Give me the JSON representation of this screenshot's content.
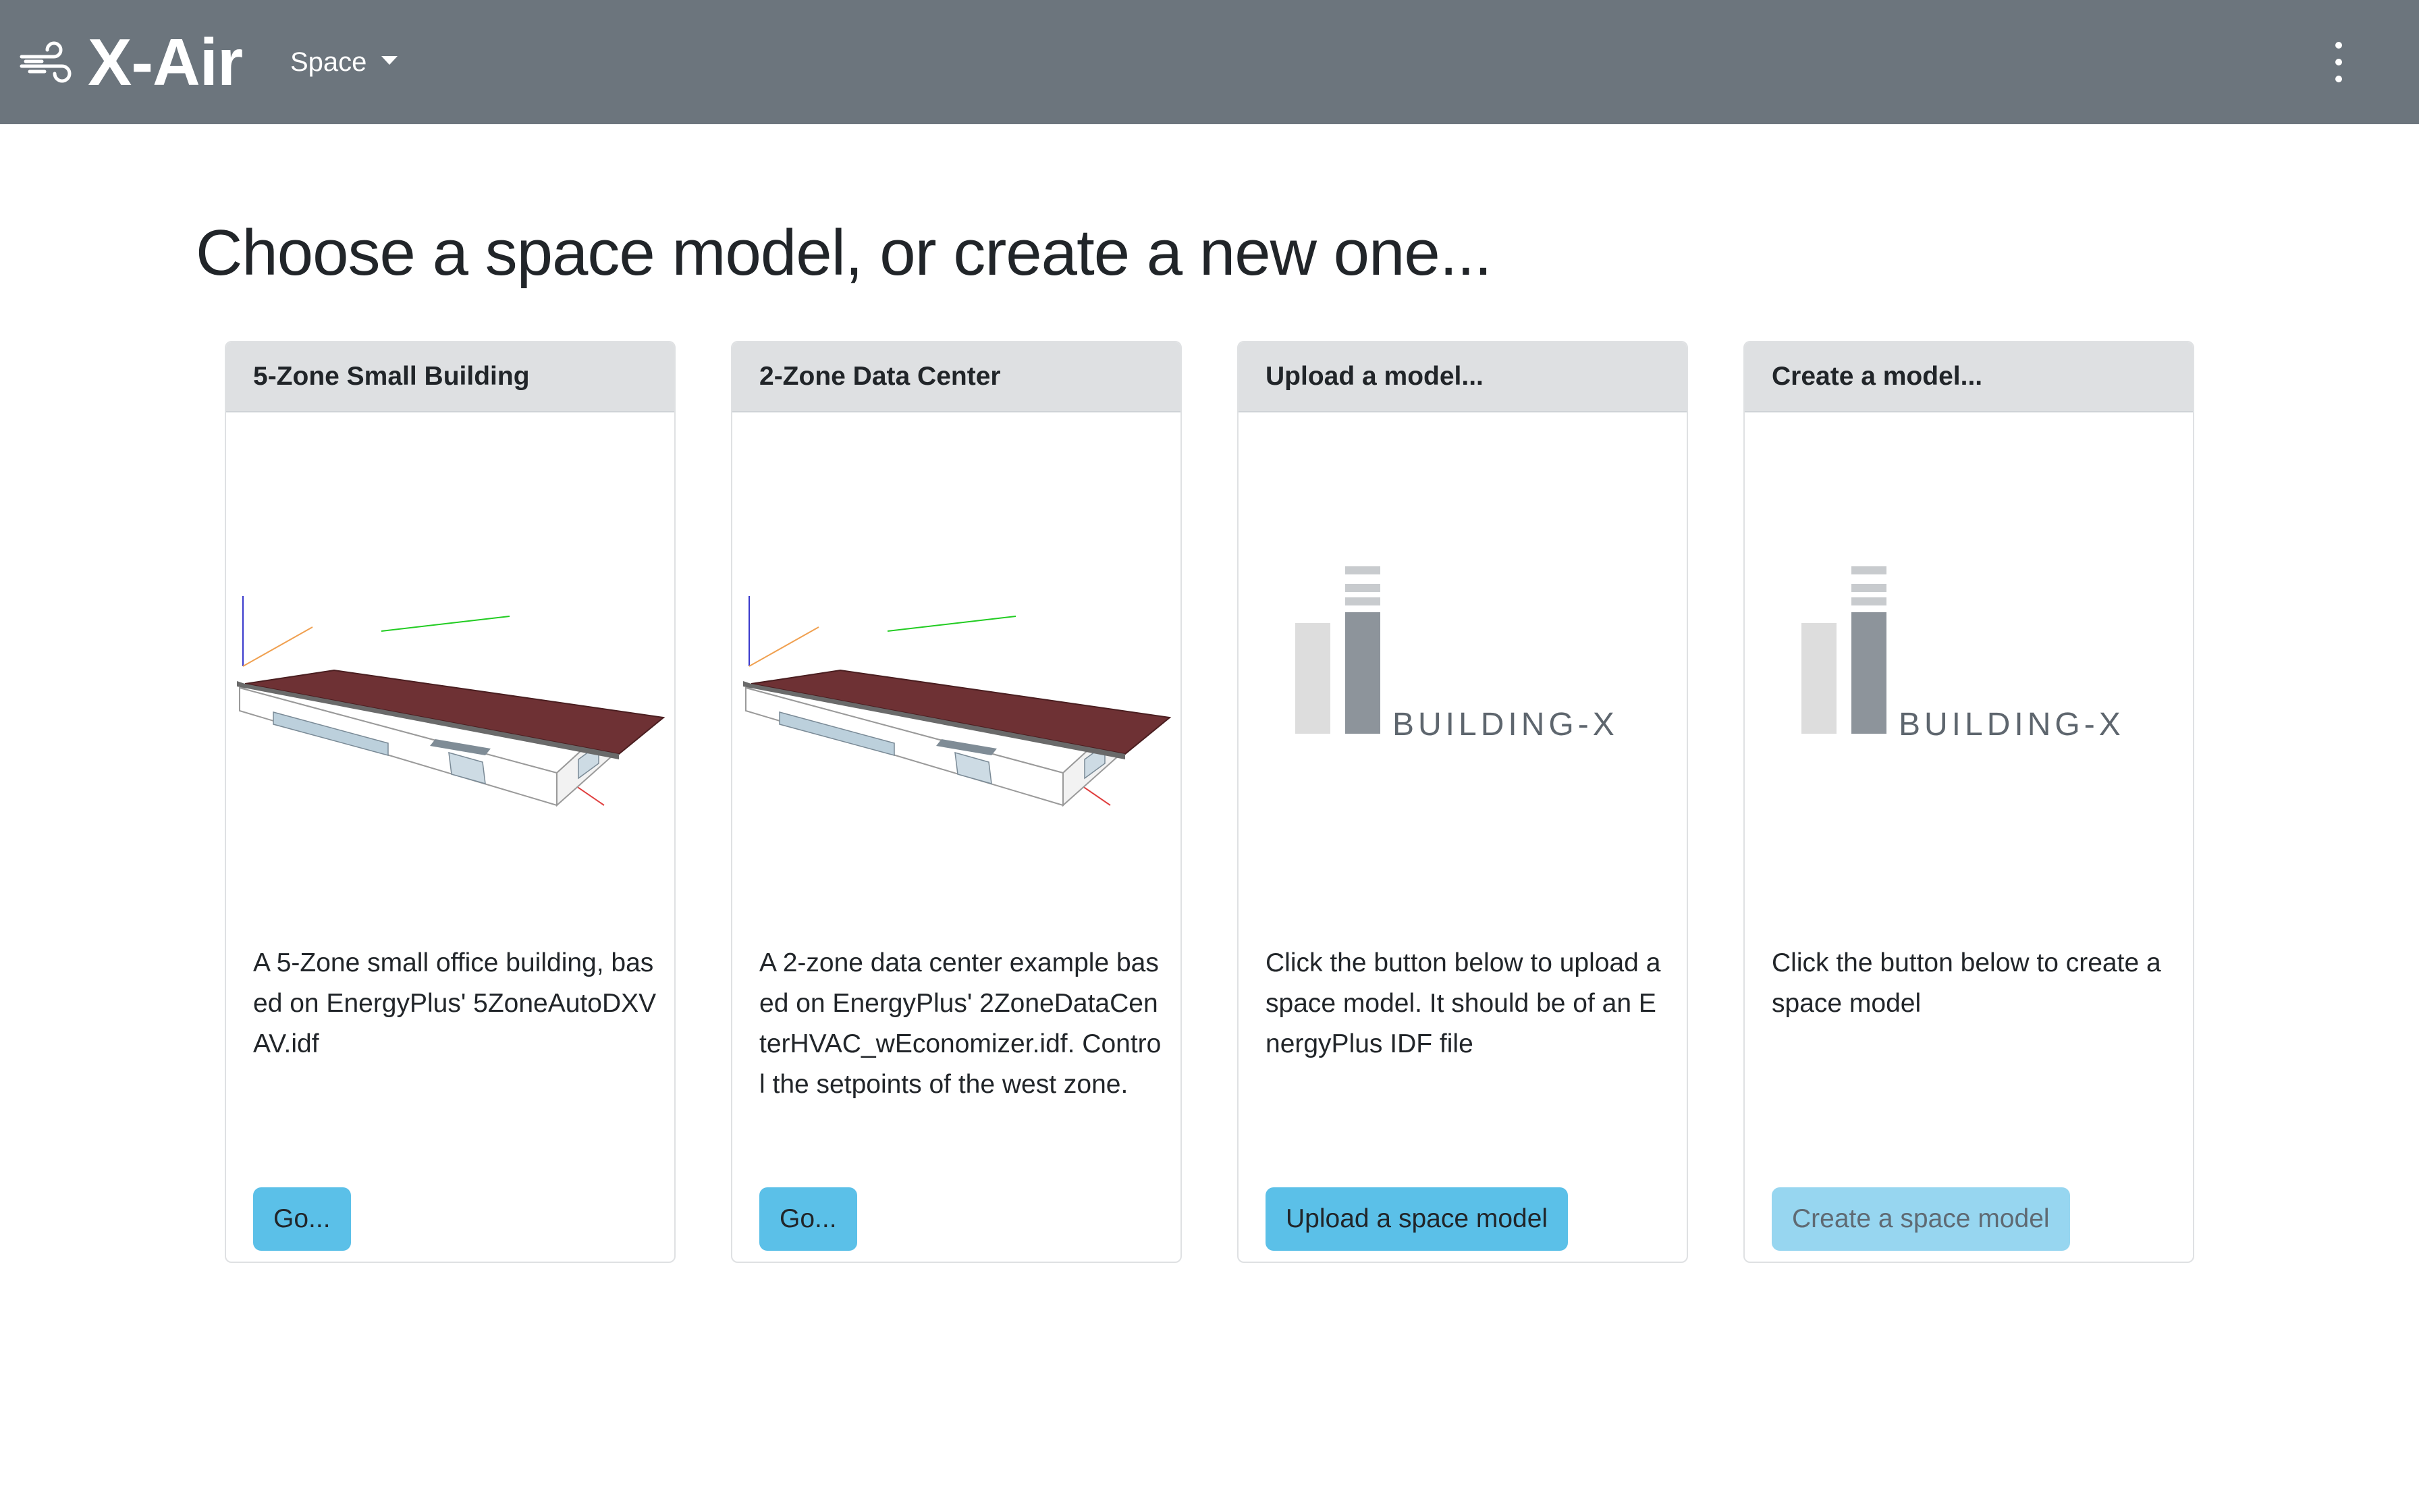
{
  "app": {
    "name": "X-Air",
    "icon": "wind-icon"
  },
  "nav": {
    "space_menu_label": "Space",
    "more_icon": "kebab-menu-icon"
  },
  "page": {
    "title": "Choose a space model, or create a new one..."
  },
  "cards": [
    {
      "header": "5-Zone Small Building",
      "image": "building-model-render",
      "text": "A 5-Zone small office building, based on EnergyPlus' 5ZoneAutoDXVAV.idf",
      "button": "Go...",
      "button_disabled": false
    },
    {
      "header": "2-Zone Data Center",
      "image": "building-model-render",
      "text": "A 2-zone data center example based on EnergyPlus' 2ZoneDataCenterHVAC_wEconomizer.idf. Control the setpoints of the west zone.",
      "button": "Go...",
      "button_disabled": false
    },
    {
      "header": "Upload a model...",
      "image": "building-x-logo",
      "logo_text": "BUILDING-X",
      "text": "Click the button below to upload a space model. It should be of an EnergyPlus IDF file",
      "button": "Upload a space model",
      "button_disabled": false
    },
    {
      "header": "Create a model...",
      "image": "building-x-logo",
      "logo_text": "BUILDING-X",
      "text": "Click the button below to create a space model",
      "button": "Create a space model",
      "button_disabled": true
    }
  ],
  "colors": {
    "navbar": "#6c757d",
    "button": "#5bc0e8",
    "button_disabled": "#97d6f0",
    "roof": "#6e3134"
  }
}
